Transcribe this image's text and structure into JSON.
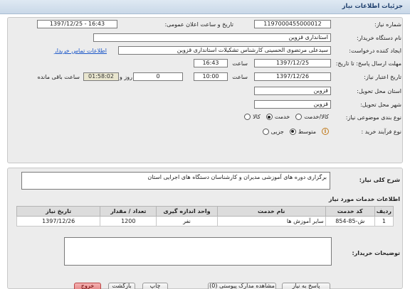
{
  "title": "جزئیات اطلاعات نیاز",
  "form": {
    "need_number_label": "شماره نیاز:",
    "need_number_value": "1197000455000012",
    "announce_label": "تاریخ و ساعت اعلان عمومی:",
    "announce_value": "1397/12/25 - 16:43",
    "buyer_org_label": "نام دستگاه خریدار:",
    "buyer_org_value": "استانداری قزوین",
    "creator_label": "ایجاد کننده درخواست:",
    "creator_value": "سیدعلی مرتضوی الحسینی کارشناس تشکیلات استانداری قزوین",
    "contact_link": "اطلاعات تماس خریدار",
    "reply_deadline_label": "مهلت ارسال پاسخ: تا تاریخ:",
    "reply_date": "1397/12/25",
    "hour_label": "ساعت",
    "reply_time": "16:43",
    "validity_label": "تاریخ اعتبار نیاز:",
    "validity_date": "1397/12/26",
    "validity_time": "10:00",
    "days_value": "0",
    "days_label": "روز و",
    "remaining_time": "01:58:02",
    "remaining_label": "ساعت باقی مانده",
    "delivery_province_label": "استان محل تحویل:",
    "delivery_province_value": "قزوین",
    "delivery_city_label": "شهر محل تحویل:",
    "delivery_city_value": "قزوین",
    "category_label": "نوع بندی موضوعی نیاز:",
    "category_options": [
      "کالا",
      "خدمت",
      "کالا/خدمت"
    ],
    "category_selected": "خدمت",
    "process_label": "نوع فرآیند خرید :",
    "process_options": [
      "جزیی",
      "متوسط"
    ],
    "process_selected": "متوسط"
  },
  "need_description": {
    "label": "شرح کلی نیاز:",
    "value": "برگزاری دوره های آموزشی مدیران و کارشناسان دستگاه های اجرایی استان"
  },
  "services": {
    "title": "اطلاعات خدمات مورد نیاز",
    "headers": [
      "ردیف",
      "کد خدمت",
      "نام خدمت",
      "واحد اندازه گیری",
      "تعداد / مقدار",
      "تاریخ نیاز"
    ],
    "rows": [
      [
        "1",
        "ش-85-854",
        "سایر آموزش ها",
        "نفر",
        "1200",
        "1397/12/26"
      ]
    ]
  },
  "buyer_notes": {
    "label": "توضیحات خریدار:",
    "value": ""
  },
  "buttons": {
    "reply": "پاسخ به نیاز",
    "view_docs": "مشاهده مدارک پیوستی (0)",
    "print": "چاپ",
    "back": "بازگشت",
    "exit": "خروج"
  }
}
